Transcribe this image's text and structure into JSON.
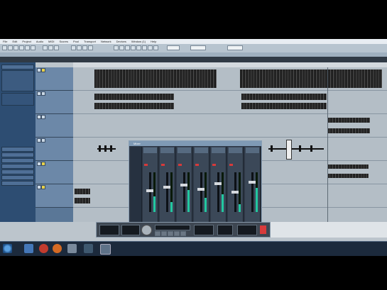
{
  "menu": [
    "File",
    "Edit",
    "Project",
    "Audio",
    "MIDI",
    "Scores",
    "Pool",
    "Transport",
    "Network",
    "Devices",
    "Window (1)",
    "Help"
  ],
  "mixer": {
    "title": "Mixer"
  },
  "clock": {
    "time": "",
    "date": ""
  },
  "colors": {
    "inspector": "#2d4d72",
    "meter": "#22c7a0",
    "accent_red": "#d63a3a"
  }
}
